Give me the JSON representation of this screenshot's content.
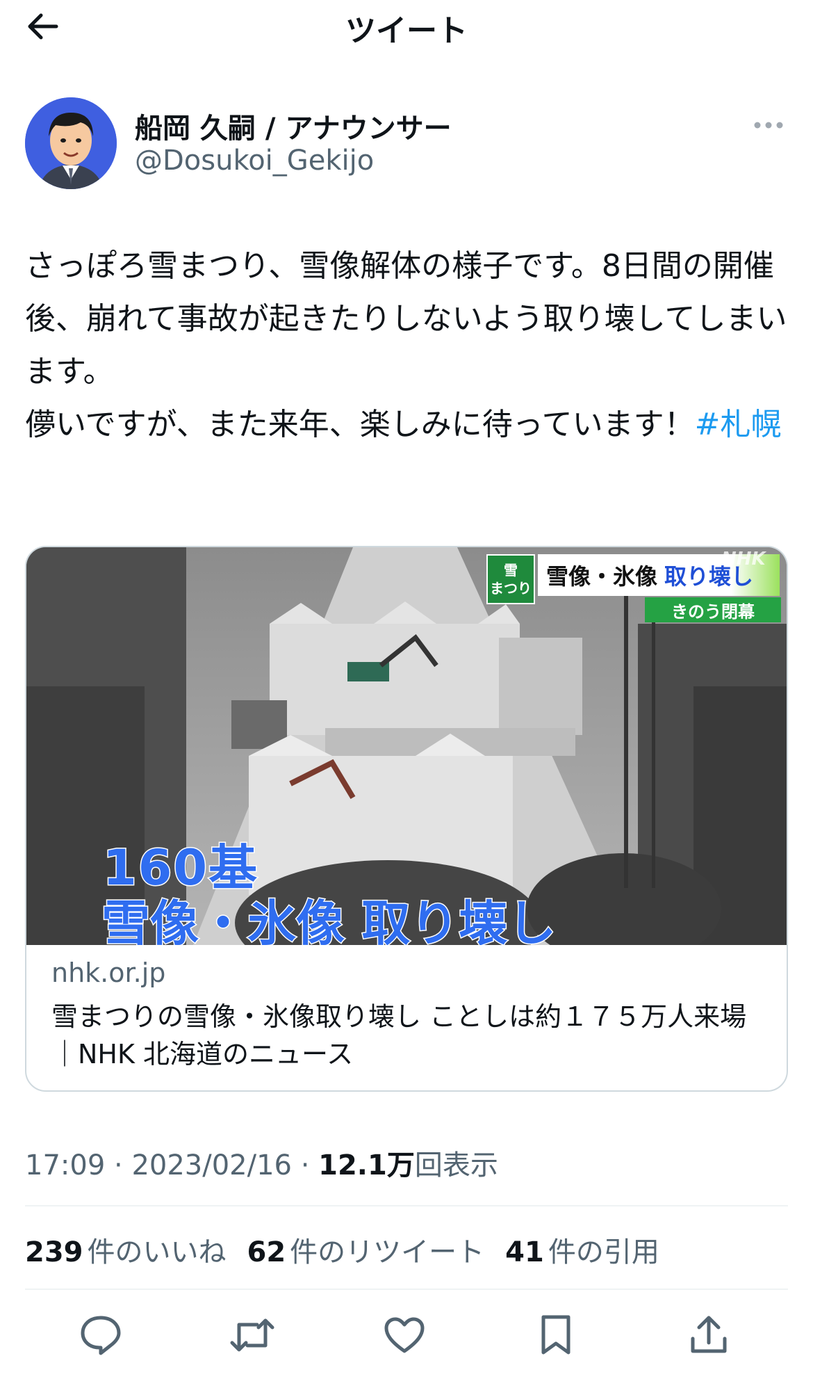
{
  "header": {
    "title": "ツイート"
  },
  "author": {
    "display_name": "船岡 久嗣 / アナウンサー",
    "handle": "@Dosukoi_Gekijo"
  },
  "tweet": {
    "text": "さっぽろ雪まつり、雪像解体の様子です。8日間の開催後、崩れて事故が起きたりしないよう取り壊してしまいます。\n儚いですが、また来年、楽しみに待っています！",
    "hashtag": "#札幌"
  },
  "card": {
    "image": {
      "count_overlay": "160基",
      "caption_overlay": "雪像・氷像 取り壊し",
      "logo_text": "雪\nまつり",
      "title_bar_a": "雪像・氷像",
      "title_bar_b": "取り壊し",
      "sub_bar": "きのう閉幕",
      "channel": "NHK"
    },
    "domain": "nhk.or.jp",
    "title": "雪まつりの雪像・氷像取り壊し ことしは約１７５万人来場｜NHK 北海道のニュース"
  },
  "meta": {
    "time": "17:09",
    "date": "2023/02/16",
    "separator": " · ",
    "views_count": "12.1万",
    "views_label": "回表示"
  },
  "stats": {
    "likes_count": "239",
    "likes_label": "件のいいね",
    "retweets_count": "62",
    "retweets_label": "件のリツイート",
    "quotes_count": "41",
    "quotes_label": "件の引用"
  },
  "icons": {
    "back": "arrow-left-icon",
    "more": "more-horizontal-icon",
    "reply": "reply-icon",
    "retweet": "retweet-icon",
    "like": "heart-icon",
    "bookmark": "bookmark-icon",
    "share": "share-icon"
  },
  "colors": {
    "link": "#1d9bf0",
    "secondary_text": "#536471",
    "primary_text": "#0f1419",
    "border": "#cfd9de"
  }
}
